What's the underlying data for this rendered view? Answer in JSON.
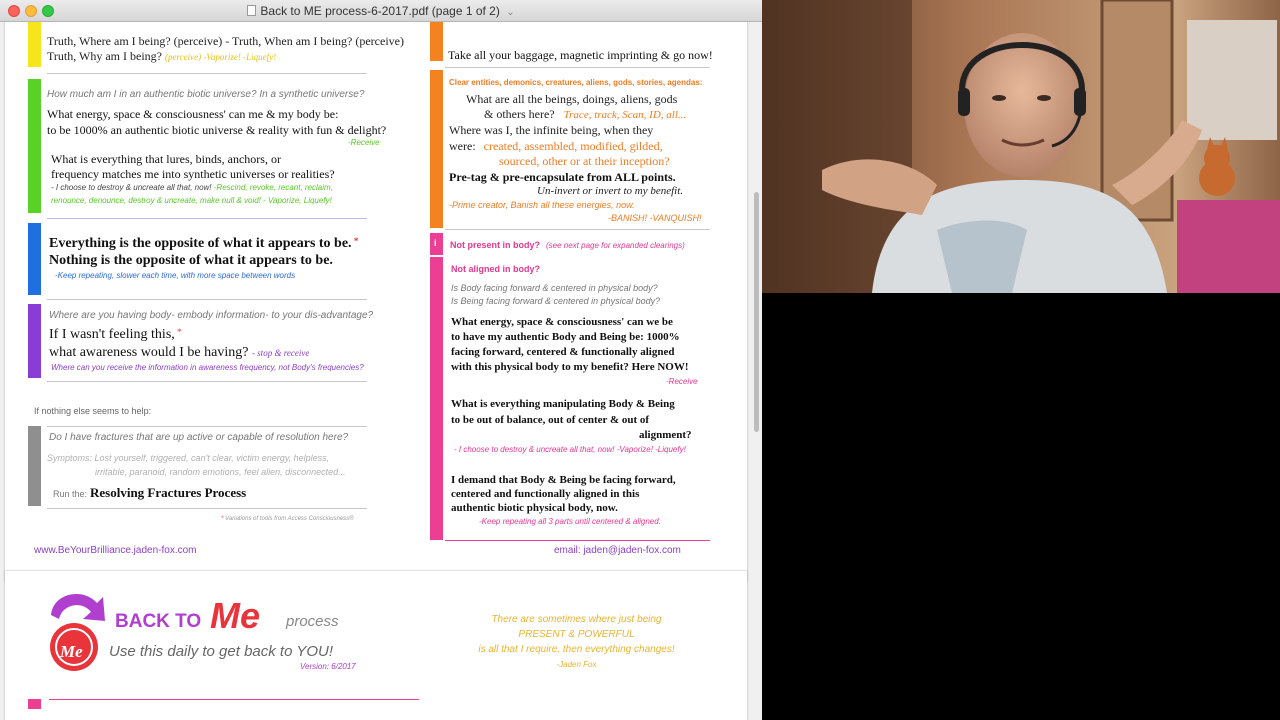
{
  "window": {
    "title": "Back to ME process-6-2017.pdf (page 1 of 2)",
    "chevron": "⌄"
  },
  "left": {
    "truth_top": "Truth, Where am I being? (perceive) - Truth, When am I being? (perceive)",
    "truth_why": "Truth, Why am I being?",
    "truth_why_tag": "(perceive)   -Vaporize! -Liquefy!",
    "green_q1": "How much am I in an authentic biotic universe?  In a synthetic universe?",
    "green_q2a": "What energy, space & consciousness' can me & my body be:",
    "green_q2b": "to be 1000% an authentic biotic universe & reality with fun & delight?",
    "green_receive": "-Receive",
    "green_q3a": "What is everything that lures, binds, anchors, or",
    "green_q3b": "frequency matches me into synthetic universes or realities?",
    "green_tag1": "- I choose to destroy & uncreate all that, now!",
    "green_tag1b": "-Rescind, revoke, recant, reclaim,",
    "green_tag2": "renounce, denounce, destroy & uncreate, make null & void!  - Vaporize, Liquefy!",
    "blue_l1": "Everything is the opposite of what it appears to be.",
    "blue_l2": "Nothing is the opposite of what it appears to be.",
    "blue_note": "-Keep repeating, slower each time, with more space between words",
    "purple_q": "Where are you having body- embody information- to your dis-advantage?",
    "purple_l1": "If I wasn't feeling this,",
    "purple_l2": "what awareness would I be having?",
    "purple_tag": "- stop & receive",
    "purple_note": "Where can you receive the information in awareness frequency, not Body's frequencies?",
    "help": "If nothing else seems to help:",
    "gray_q": "Do I have fractures that are up active or capable of resolution here?",
    "gray_sym1": "Symptoms: Lost yourself, triggered, can't clear, victim energy, helpless,",
    "gray_sym2": "irritable, paranoid, random emotions, feel alien, disconnected...",
    "run_the": "Run the:",
    "process": "Resolving Fractures Process",
    "footnote": "Variations of tools from Access Consciousness®",
    "website": "www.BeYourBrilliance.jaden-fox.com"
  },
  "right": {
    "baggage": "Take all your baggage, magnetic imprinting & go now!",
    "clear_head": "Clear entities, demonics, creatures, aliens, gods, stories, agendas:",
    "clear_q1a": "What are all the beings, doings, aliens, gods",
    "clear_q1b": "& others here?",
    "clear_q1c": "Trace, track, Scan, ID, all...",
    "clear_q2a": "Where was I, the infinite being, when they",
    "clear_q2b": "were:",
    "clear_q2c": "created, assembled, modified, gilded,",
    "clear_q2d": "sourced, other or at their inception?",
    "pretag": "Pre-tag & pre-encapsulate from ALL points.",
    "uninvert": "Un-invert or invert to my benefit.",
    "prime": "-Prime creator, Banish all these energies, now.",
    "banish": "-BANISH! -VANQUISH!",
    "np_head": "Not present in body?",
    "np_note": "(see next page for expanded clearings)",
    "na_head": "Not aligned in body?",
    "na_q1": "Is Body facing forward & centered in physical body?",
    "na_q2": "Is Being facing forward & centered in physical body?",
    "na_q3a": "What energy, space & consciousness' can we be",
    "na_q3b": "to have my authentic Body and Being be: 1000%",
    "na_q3c": "facing forward, centered & functionally aligned",
    "na_q3d": "with this physical body to my benefit? Here NOW!",
    "na_receive": "-Receive",
    "na_q4a": "What is everything manipulating Body & Being",
    "na_q4b": "to be out of balance, out of center & out of",
    "na_q4c": "alignment?",
    "na_tag": "- I choose to destroy & uncreate all that, now!  -Vaporize! -Liquefy!",
    "na_q5a": "I demand that Body & Being be facing forward,",
    "na_q5b": "centered and functionally aligned in this",
    "na_q5c": "authentic biotic physical body, now.",
    "na_note": "-Keep repeating all 3 parts until centered & aligned.",
    "email": "email:  jaden@jaden-fox.com"
  },
  "page2": {
    "logo_text": "Me",
    "back_to": "BACK TO",
    "me": "Me",
    "process": "process",
    "tagline": "Use this daily to get back to YOU!",
    "version": "Version: 6/2017",
    "quote1": "There are sometimes where just being",
    "quote2": "PRESENT & POWERFUL",
    "quote3": "is all that I require, then everything changes!",
    "quote4": "-Jaden Fox"
  },
  "colors": {
    "yellow": "#f4e61b",
    "green": "#5ad127",
    "blue": "#1f6fe0",
    "purple": "#8a3cd6",
    "gray": "#8f8f8f",
    "orange": "#f58220",
    "pink": "#ec3f94"
  }
}
